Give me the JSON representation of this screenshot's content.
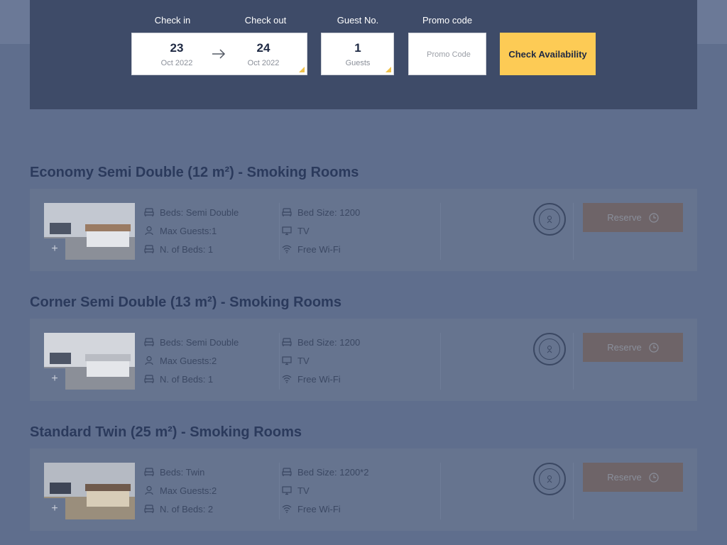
{
  "search": {
    "checkin_label": "Check in",
    "checkout_label": "Check out",
    "guests_label": "Guest No.",
    "promo_label": "Promo code",
    "checkin": {
      "day": "23",
      "month_year": "Oct 2022"
    },
    "checkout": {
      "day": "24",
      "month_year": "Oct 2022"
    },
    "guests": {
      "count": "1",
      "unit": "Guests"
    },
    "promo_placeholder": "Promo Code",
    "promo_value": "",
    "button_label": "Check Availability"
  },
  "rooms": [
    {
      "title": "Economy Semi Double (12 m²) - Smoking Rooms",
      "features_left": [
        "Beds: Semi Double",
        "Max Guests:1",
        "N. of Beds: 1"
      ],
      "features_right": [
        "Bed Size: 1200",
        "TV",
        "Free Wi-Fi"
      ],
      "reserve_label": "Reserve"
    },
    {
      "title": "Corner Semi Double (13 m²) - Smoking Rooms",
      "features_left": [
        "Beds: Semi Double",
        "Max Guests:2",
        "N. of Beds: 1"
      ],
      "features_right": [
        "Bed Size: 1200",
        "TV",
        "Free Wi-Fi"
      ],
      "reserve_label": "Reserve"
    },
    {
      "title": "Standard Twin (25 m²) - Smoking Rooms",
      "features_left": [
        "Beds: Twin",
        "Max Guests:2",
        "N. of Beds: 2"
      ],
      "features_right": [
        "Bed Size: 1200*2",
        "TV",
        "Free Wi-Fi"
      ],
      "reserve_label": "Reserve"
    }
  ],
  "icons": {
    "bed": "bed-icon",
    "person": "person-icon",
    "tv": "tv-icon",
    "wifi": "wifi-icon",
    "arrow": "arrow-right-icon",
    "clock": "clock-icon",
    "plus": "plus-icon",
    "badge": "best-price-badge-icon"
  },
  "colors": {
    "accent_button": "#fdcb55",
    "panel": "#3e4b68",
    "reserve_button": "#6e6468"
  }
}
